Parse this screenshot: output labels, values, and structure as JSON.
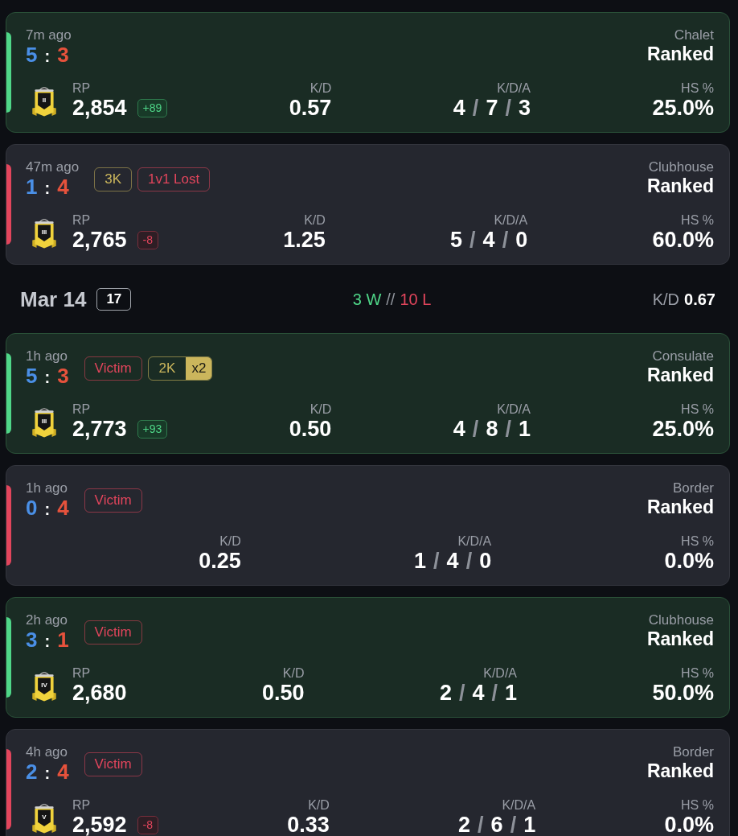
{
  "sections": [
    {
      "matches": [
        {
          "won": true,
          "time": "7m ago",
          "score": {
            "blue": "5",
            "separator": ":",
            "red": "3"
          },
          "map": "Chalet",
          "mode": "Ranked",
          "rank_tier": "II",
          "rp_label": "RP",
          "rp": "2,854",
          "rp_change": {
            "text": "+89",
            "kind": "gain"
          },
          "kd": {
            "label": "K/D",
            "value": "0.57"
          },
          "kda": {
            "label": "K/D/A",
            "values": [
              "4",
              "7",
              "3"
            ],
            "separators": [
              "/",
              "/"
            ]
          },
          "hs": {
            "label": "HS %",
            "value": "25.0%"
          }
        },
        {
          "won": false,
          "time": "47m ago",
          "score": {
            "blue": "1",
            "separator": ":",
            "red": "4"
          },
          "tags": [
            {
              "text": "3K",
              "color": "#cbb65c"
            },
            {
              "text": "1v1 Lost",
              "color": "#e2455c"
            }
          ],
          "map": "Clubhouse",
          "mode": "Ranked",
          "rank_tier": "III",
          "rp_label": "RP",
          "rp": "2,765",
          "rp_change": {
            "text": "-8",
            "kind": "loss"
          },
          "kd": {
            "label": "K/D",
            "value": "1.25"
          },
          "kda": {
            "label": "K/D/A",
            "values": [
              "5",
              "4",
              "0"
            ],
            "separators": [
              "/",
              "/"
            ]
          },
          "hs": {
            "label": "HS %",
            "value": "60.0%"
          }
        }
      ]
    },
    {
      "header": {
        "date": "Mar 14",
        "count": "17",
        "record": {
          "wins": "3 W",
          "separator": "//",
          "losses": "10 L"
        },
        "kd": {
          "label": "K/D",
          "value": "0.67"
        }
      },
      "matches": [
        {
          "won": true,
          "time": "1h ago",
          "score": {
            "blue": "5",
            "separator": ":",
            "red": "3"
          },
          "tags": [
            {
              "text": "Victim",
              "color": "#e2455c"
            },
            {
              "text": "2K",
              "color": "#cbb65c",
              "multiplier": "x2"
            }
          ],
          "map": "Consulate",
          "mode": "Ranked",
          "rank_tier": "III",
          "rp_label": "RP",
          "rp": "2,773",
          "rp_change": {
            "text": "+93",
            "kind": "gain"
          },
          "kd": {
            "label": "K/D",
            "value": "0.50"
          },
          "kda": {
            "label": "K/D/A",
            "values": [
              "4",
              "8",
              "1"
            ],
            "separators": [
              "/",
              "/"
            ]
          },
          "hs": {
            "label": "HS %",
            "value": "25.0%"
          }
        },
        {
          "won": false,
          "time": "1h ago",
          "score": {
            "blue": "0",
            "separator": ":",
            "red": "4"
          },
          "tags": [
            {
              "text": "Victim",
              "color": "#e2455c"
            }
          ],
          "map": "Border",
          "mode": "Ranked",
          "kd": {
            "label": "K/D",
            "value": "0.25"
          },
          "kda": {
            "label": "K/D/A",
            "values": [
              "1",
              "4",
              "0"
            ],
            "separators": [
              "/",
              "/"
            ]
          },
          "hs": {
            "label": "HS %",
            "value": "0.0%"
          }
        },
        {
          "won": true,
          "time": "2h ago",
          "score": {
            "blue": "3",
            "separator": ":",
            "red": "1"
          },
          "tags": [
            {
              "text": "Victim",
              "color": "#e2455c"
            }
          ],
          "map": "Clubhouse",
          "mode": "Ranked",
          "rank_tier": "IV",
          "rp_label": "RP",
          "rp": "2,680",
          "kd": {
            "label": "K/D",
            "value": "0.50"
          },
          "kda": {
            "label": "K/D/A",
            "values": [
              "2",
              "4",
              "1"
            ],
            "separators": [
              "/",
              "/"
            ]
          },
          "hs": {
            "label": "HS %",
            "value": "50.0%"
          }
        },
        {
          "won": false,
          "time": "4h ago",
          "score": {
            "blue": "2",
            "separator": ":",
            "red": "4"
          },
          "tags": [
            {
              "text": "Victim",
              "color": "#e2455c"
            }
          ],
          "map": "Border",
          "mode": "Ranked",
          "rank_tier": "V",
          "rp_label": "RP",
          "rp": "2,592",
          "rp_change": {
            "text": "-8",
            "kind": "loss"
          },
          "kd": {
            "label": "K/D",
            "value": "0.33"
          },
          "kda": {
            "label": "K/D/A",
            "values": [
              "2",
              "6",
              "1"
            ],
            "separators": [
              "/",
              "/"
            ]
          },
          "hs": {
            "label": "HS %",
            "value": "0.0%"
          }
        }
      ]
    }
  ]
}
